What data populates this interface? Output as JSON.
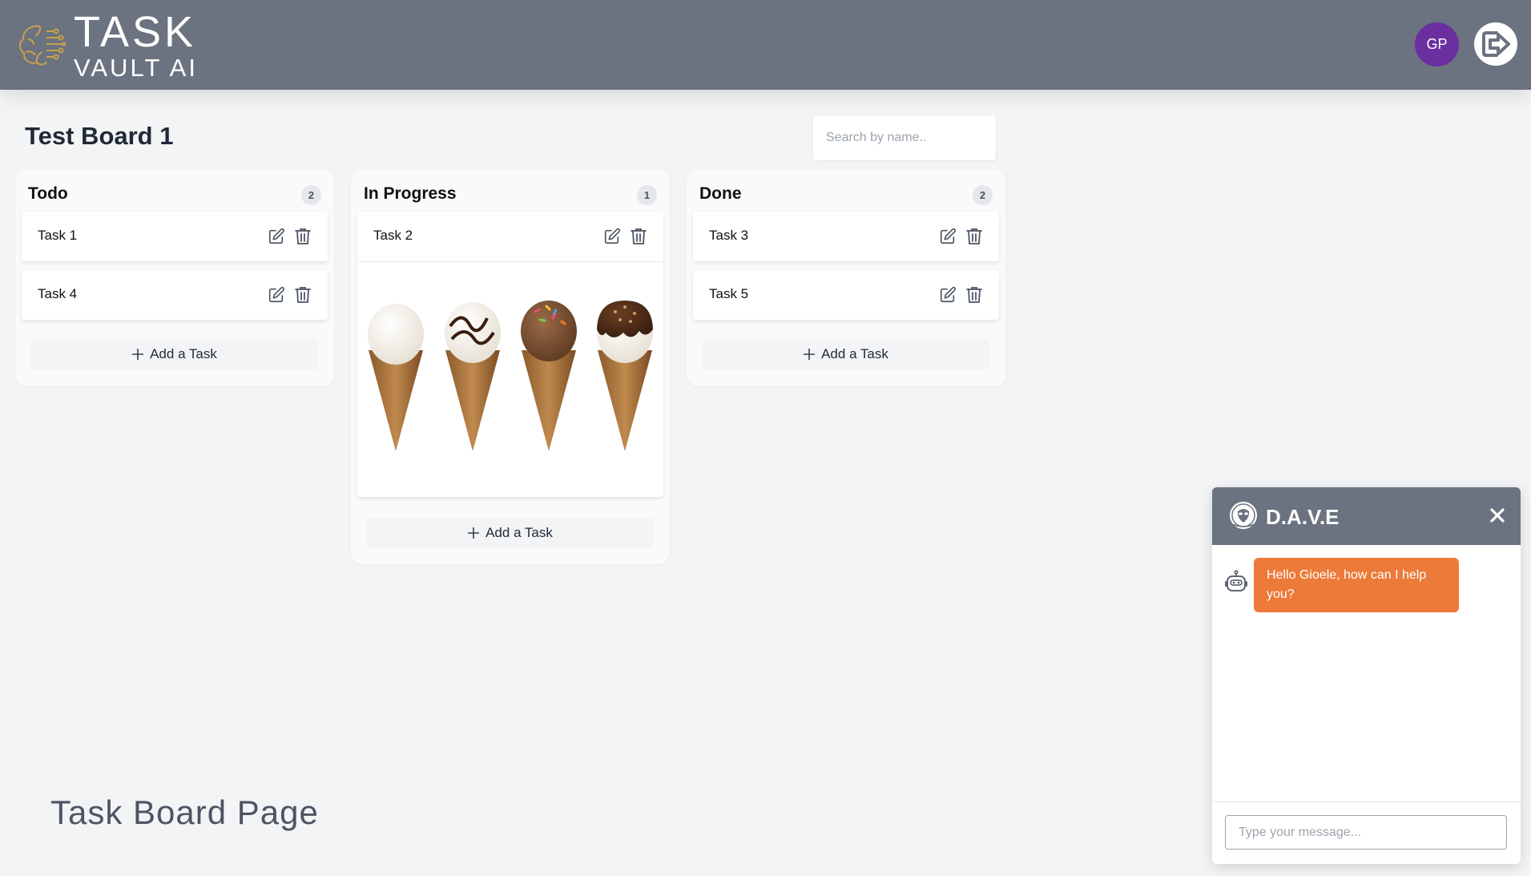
{
  "header": {
    "logo_line1": "TASK",
    "logo_line2": "VAULT AI",
    "avatar_initials": "GP",
    "bg_color": "#6b7280",
    "avatar_color": "#6b2fa0"
  },
  "board": {
    "title": "Test Board 1",
    "search_placeholder": "Search by name.."
  },
  "columns": [
    {
      "title": "Todo",
      "count": "2",
      "tasks": [
        {
          "label": "Task 1"
        },
        {
          "label": "Task 4"
        }
      ],
      "add_label": "Add a Task"
    },
    {
      "title": "In Progress",
      "count": "1",
      "tasks": [
        {
          "label": "Task 2",
          "image": "ice-cream-cones"
        }
      ],
      "add_label": "Add a Task"
    },
    {
      "title": "Done",
      "count": "2",
      "tasks": [
        {
          "label": "Task 3"
        },
        {
          "label": "Task 5"
        }
      ],
      "add_label": "Add a Task"
    }
  ],
  "page_caption": "Task Board Page",
  "chat": {
    "title": "D.A.V.E",
    "messages": [
      {
        "from": "bot",
        "text": "Hello Gioele, how can I help you?"
      }
    ],
    "input_placeholder": "Type your message...",
    "bubble_color": "#ec7a38"
  },
  "icons": {
    "logo": "brain-circuit-icon",
    "logout": "logout-arrow-icon",
    "edit": "edit-icon",
    "delete": "trash-icon",
    "add": "plus-icon",
    "close": "close-icon",
    "bot": "robot-icon",
    "chat_logo": "alien-globe-icon"
  }
}
